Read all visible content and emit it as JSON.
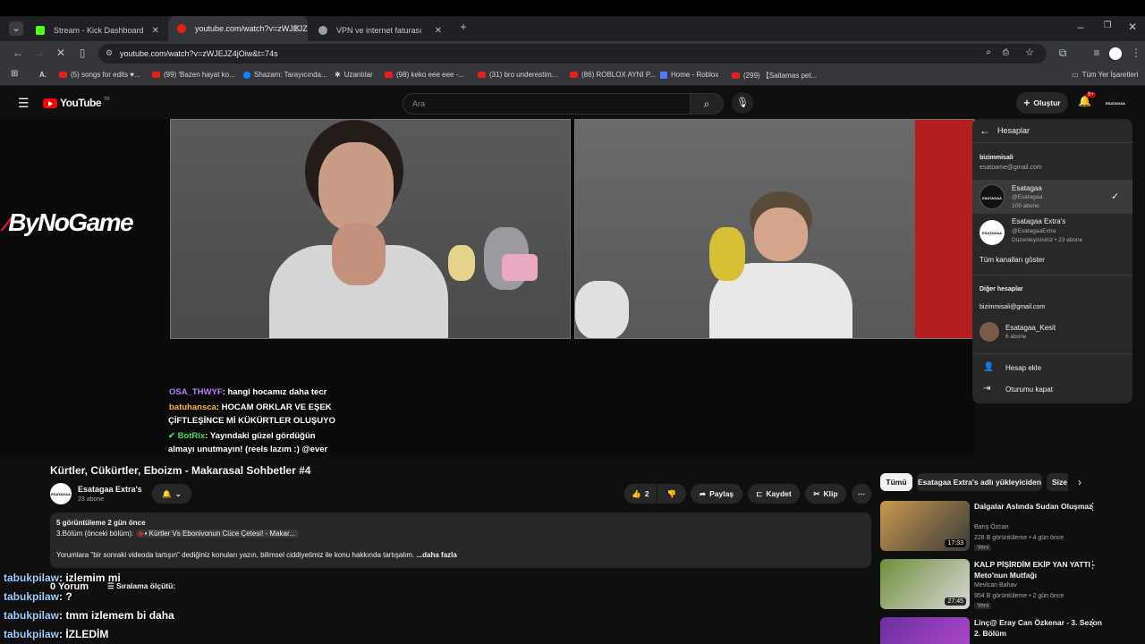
{
  "tabs": [
    {
      "title": "Stream - Kick Dashboard",
      "fav_color": "#53fc18"
    },
    {
      "title": "youtube.com/watch?v=zWJEJZ",
      "fav_color": "#e62117"
    },
    {
      "title": "VPN ve internet faturası",
      "fav_color": "#9aa0a6"
    }
  ],
  "url": "youtube.com/watch?v=zWJEJZ4jOiw&t=74s",
  "bookmarks": [
    "(5) songs for edits ♥...",
    "(99) 'Bazen hayat ko...",
    "Shazam: Tarayıcında...",
    "Uzantılar",
    "(98) keko eee eee -...",
    "(31) bro underestim...",
    "(86) ROBLOX AYNI P...",
    "Home - Roblox",
    "(299) 【Saitamas pet..."
  ],
  "bookmarks_all": "Tüm Yer İşaretleri",
  "youtube": {
    "logo": "YouTube",
    "region": "TR",
    "search_placeholder": "Ara",
    "create_label": "Oluştur",
    "notif_count": "9+"
  },
  "overlay": {
    "sponsor": "ByNoGame",
    "chat": [
      {
        "user": "OSA_THWYF",
        "text": ": hangi hocamız daha tecr",
        "user_color": "#b57cff"
      },
      {
        "user": "batuhansca",
        "text": ": HOCAM ORKLAR VE EŞEK",
        "user_color": "#ffb347"
      },
      {
        "user": "",
        "text": "ÇİFTLEŞİNCE Mİ KÜKÜRTLER OLUŞUYO",
        "user_color": "#ffffff"
      },
      {
        "user": "BotRix",
        "text": ": Yayındaki güzel gördüğün",
        "user_color": "#4cd964"
      },
      {
        "user": "",
        "text": "almayı unutmayın! (reels lazım :) @ever",
        "user_color": "#ffffff"
      }
    ]
  },
  "account_menu": {
    "header": "Hesaplar",
    "primary_name": "bizimmisali",
    "primary_email": "esatoame@gmail.com",
    "accounts": [
      {
        "name": "Esatagaa",
        "handle": "@Esatagaa",
        "subs": "109 abone",
        "avatar": "ESATAGAA",
        "selected": true
      },
      {
        "name": "Esatagaa Extra's",
        "handle": "@EsatagaaExtra",
        "subs": "Düzenleyicisiniz • 23 abone",
        "avatar": "ESATAGAA",
        "selected": false
      }
    ],
    "show_all": "Tüm kanalları göster",
    "other_label": "Diğer hesaplar",
    "other_email": "bizimmisali@gmail.com",
    "other_account": {
      "name": "Esatagaa_Kesit",
      "subs": "6 abone"
    },
    "add_account": "Hesap ekle",
    "sign_out": "Oturumu kapat"
  },
  "video": {
    "title": "Kürtler, Cükürtler, Eboizm - Makarasal Sohbetler #4",
    "channel": "Esatagaa Extra's",
    "channel_avatar": "ESATAGAA",
    "subs": "23 abone",
    "likes": "2",
    "share": "Paylaş",
    "save": "Kaydet",
    "clip": "Klip"
  },
  "description": {
    "meta": "5 görüntüleme  2 gün önce",
    "prev_label": "3.Bölüm (önceki bölüm):",
    "prev_link": "• Kürtler Vs Ebonivonun Cüce Çetesi! - Makar...",
    "body": "Yorumlara \"bir sonraki videoda tartışın\" dediğiniz konuları yazın, bilimsel ciddiyetimiz ile konu hakkında tartışalım.",
    "more": "...daha fazla"
  },
  "comments": {
    "count": "0 Yorum",
    "sort": "Sıralama ölçütü:"
  },
  "chips": [
    "Tümü",
    "Esatagaa Extra's adlı yükleyiciden",
    "Size"
  ],
  "recommendations": [
    {
      "title": "Dalgalar Aslında Sudan Oluşmaz",
      "channel": "Barış Özcan",
      "meta": "228 B görüntüleme • 4 gün önce",
      "badge": "Yeni",
      "duration": "17:33",
      "thumb_color": "#c99a4e"
    },
    {
      "title": "KALP PİŞİRDİM EKİP YAN YATTI - Meto'nun Mutfağı",
      "channel": "Mevlcan Bahav",
      "meta": "954 B görüntüleme • 2 gün önce",
      "badge": "Yeni",
      "duration": "27:45",
      "thumb_color": "#6f8f3a"
    },
    {
      "title": "Linç@ Eray Can Özkenar - 3. Sezon 2. Bölüm",
      "channel": "",
      "meta": "",
      "badge": "",
      "duration": "",
      "thumb_color": "#6b2fa0"
    }
  ],
  "kick_chat": [
    {
      "user": "tabukpilaw",
      "text": ": izlemim mi"
    },
    {
      "user": "tabukpilaw",
      "text": ": ?"
    },
    {
      "user": "tabukpilaw",
      "text": ": tmm izlemem bi daha"
    },
    {
      "user": "tabukpilaw",
      "text": ": İZLEDİM"
    }
  ]
}
